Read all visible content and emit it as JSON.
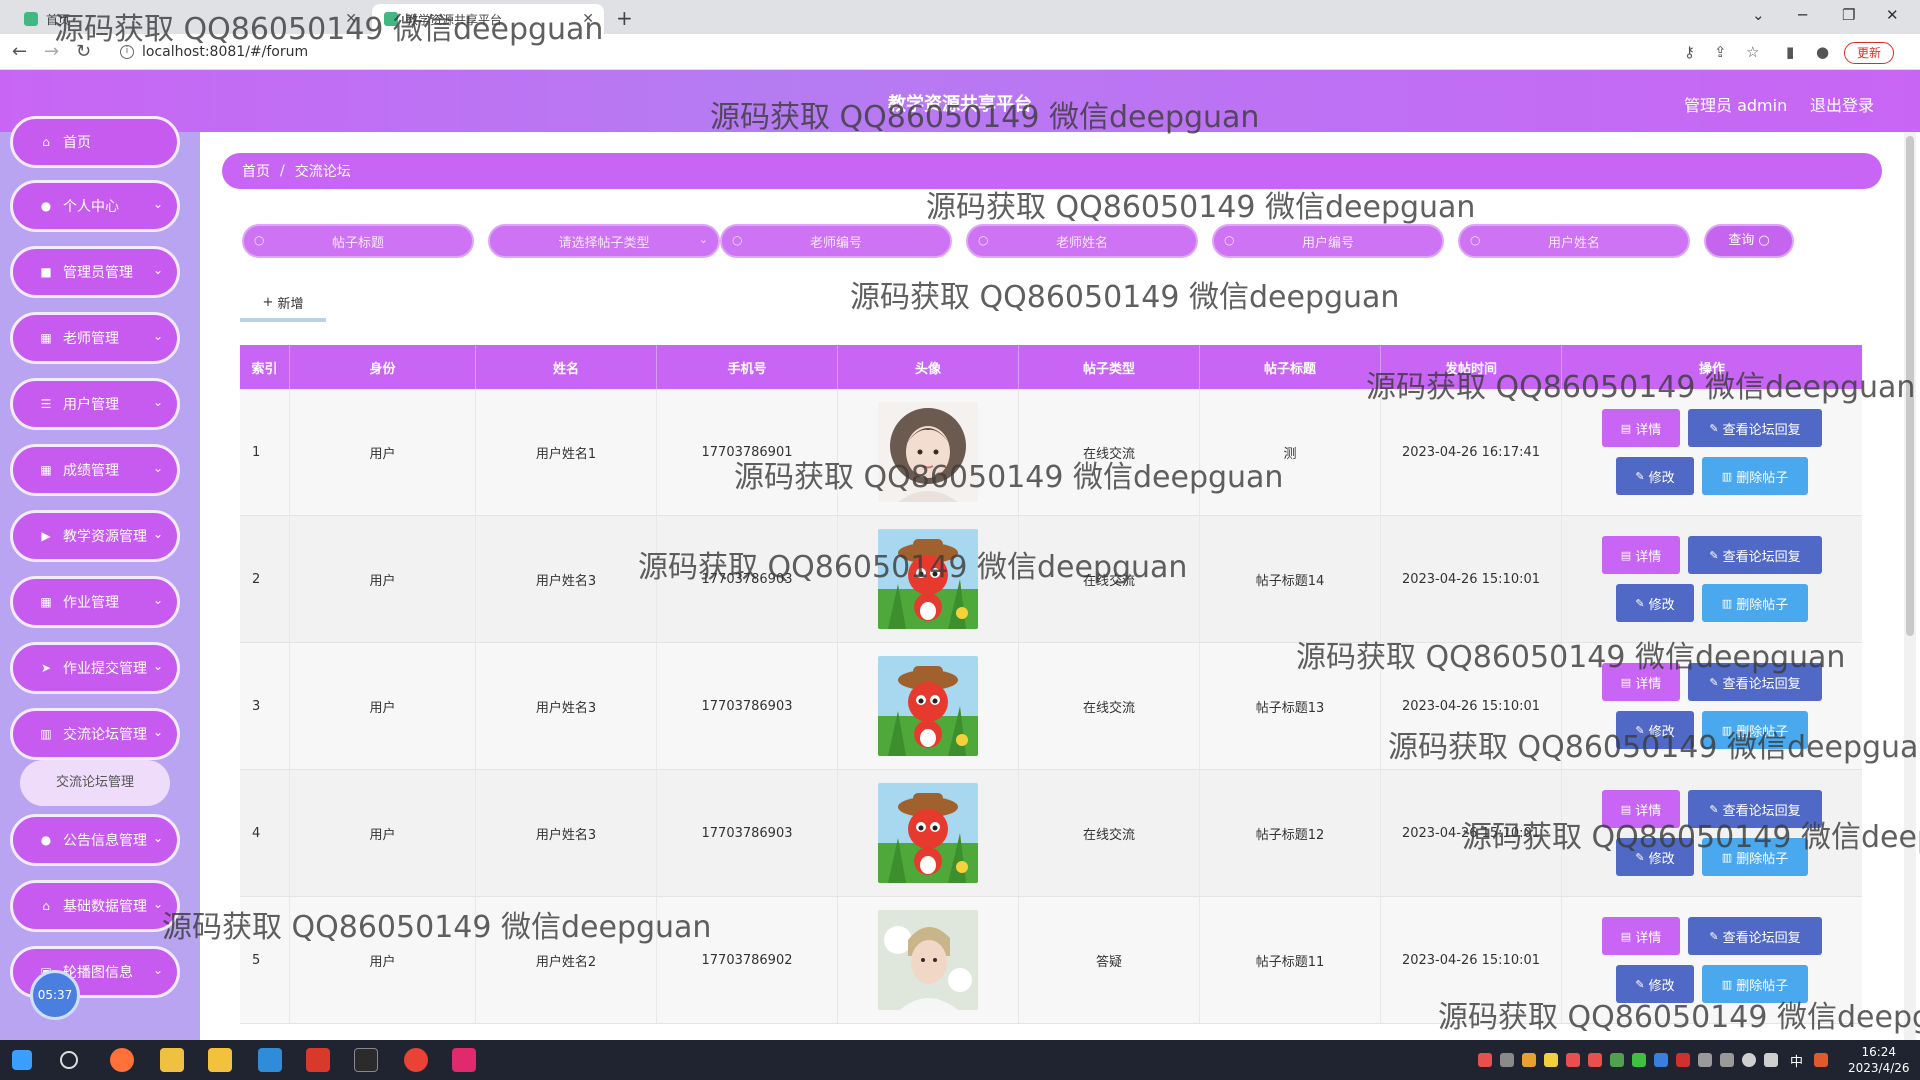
{
  "browser": {
    "tabs": [
      {
        "title": "首页",
        "active": false
      },
      {
        "title": "教学资源共享平台",
        "active": true
      }
    ],
    "url": "localhost:8081/#/forum",
    "update_label": "更新"
  },
  "header": {
    "title": "教学资源共享平台",
    "admin_label": "管理员 admin",
    "logout_label": "退出登录"
  },
  "sidebar": {
    "items": [
      {
        "label": "首页",
        "icon": "home-icon"
      },
      {
        "label": "个人中心",
        "icon": "user-icon"
      },
      {
        "label": "管理员管理",
        "icon": "clipboard-icon"
      },
      {
        "label": "老师管理",
        "icon": "grid-icon"
      },
      {
        "label": "用户管理",
        "icon": "list-icon"
      },
      {
        "label": "成绩管理",
        "icon": "grid-icon"
      },
      {
        "label": "教学资源管理",
        "icon": "video-icon"
      },
      {
        "label": "作业管理",
        "icon": "grid-icon"
      },
      {
        "label": "作业提交管理",
        "icon": "send-icon"
      },
      {
        "label": "交流论坛管理",
        "icon": "bar-chart-icon"
      },
      {
        "label": "公告信息管理",
        "icon": "bell-icon"
      },
      {
        "label": "基础数据管理",
        "icon": "house-icon"
      },
      {
        "label": "轮播图信息",
        "icon": "picture-icon"
      }
    ],
    "submenu_active": "交流论坛管理",
    "clock": "05:37"
  },
  "breadcrumb": {
    "home": "首页",
    "current": "交流论坛"
  },
  "search": {
    "title_placeholder": "帖子标题",
    "type_placeholder": "请选择帖子类型",
    "teacher_no_placeholder": "老师编号",
    "teacher_name_placeholder": "老师姓名",
    "user_no_placeholder": "用户编号",
    "user_name_placeholder": "用户姓名",
    "query_label": "查询"
  },
  "add_label": "新增",
  "table": {
    "columns": [
      "索引",
      "身份",
      "姓名",
      "手机号",
      "头像",
      "帖子类型",
      "帖子标题",
      "发帖时间",
      "操作"
    ],
    "rows": [
      {
        "index": "1",
        "role": "用户",
        "name": "用户姓名1",
        "phone": "17703786901",
        "avatar": "woman",
        "type": "在线交流",
        "title": "测",
        "time": "2023-04-26 16:17:41"
      },
      {
        "index": "2",
        "role": "用户",
        "name": "用户姓名3",
        "phone": "17703786903",
        "avatar": "cartoon",
        "type": "在线交流",
        "title": "帖子标题14",
        "time": "2023-04-26 15:10:01"
      },
      {
        "index": "3",
        "role": "用户",
        "name": "用户姓名3",
        "phone": "17703786903",
        "avatar": "cartoon",
        "type": "在线交流",
        "title": "帖子标题13",
        "time": "2023-04-26 15:10:01"
      },
      {
        "index": "4",
        "role": "用户",
        "name": "用户姓名3",
        "phone": "17703786903",
        "avatar": "cartoon",
        "type": "在线交流",
        "title": "帖子标题12",
        "time": "2023-04-26 15:10:01"
      },
      {
        "index": "5",
        "role": "用户",
        "name": "用户姓名2",
        "phone": "17703786902",
        "avatar": "man",
        "type": "答疑",
        "title": "帖子标题11",
        "time": "2023-04-26 15:10:01"
      }
    ],
    "actions": {
      "detail": "详情",
      "reply": "查看论坛回复",
      "edit": "修改",
      "delete": "删除帖子"
    }
  },
  "watermark": "源码获取 QQ86050149 微信deepguan",
  "taskbar": {
    "time": "16:24",
    "date": "2023/4/26",
    "ime": "中"
  },
  "colors": {
    "accent": "#c865f5",
    "sidebar": "#b9a4f1",
    "button_dark": "#5169c6",
    "button_light": "#4aa8ee"
  }
}
